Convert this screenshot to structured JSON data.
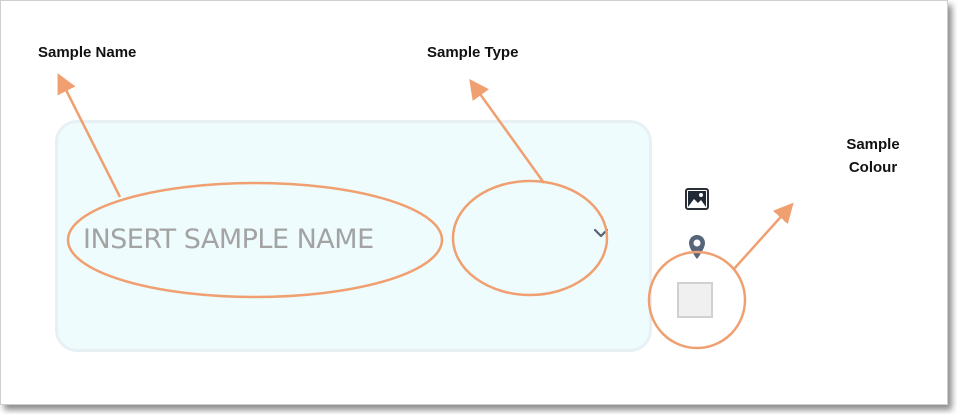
{
  "annotations": {
    "sample_name": "Sample Name",
    "sample_type": "Sample Type",
    "sample_colour_line1": "Sample",
    "sample_colour_line2": "Colour"
  },
  "form": {
    "name_placeholder": "INSERT SAMPLE NAME",
    "type_value": ""
  },
  "icons": {
    "image": "image-icon",
    "location": "location-pin-icon",
    "dropdown": "chevron-down-icon"
  },
  "colors": {
    "annotation": "#f0a070",
    "panel_background": "#eefcfd",
    "icon": "#4a5a6a"
  }
}
